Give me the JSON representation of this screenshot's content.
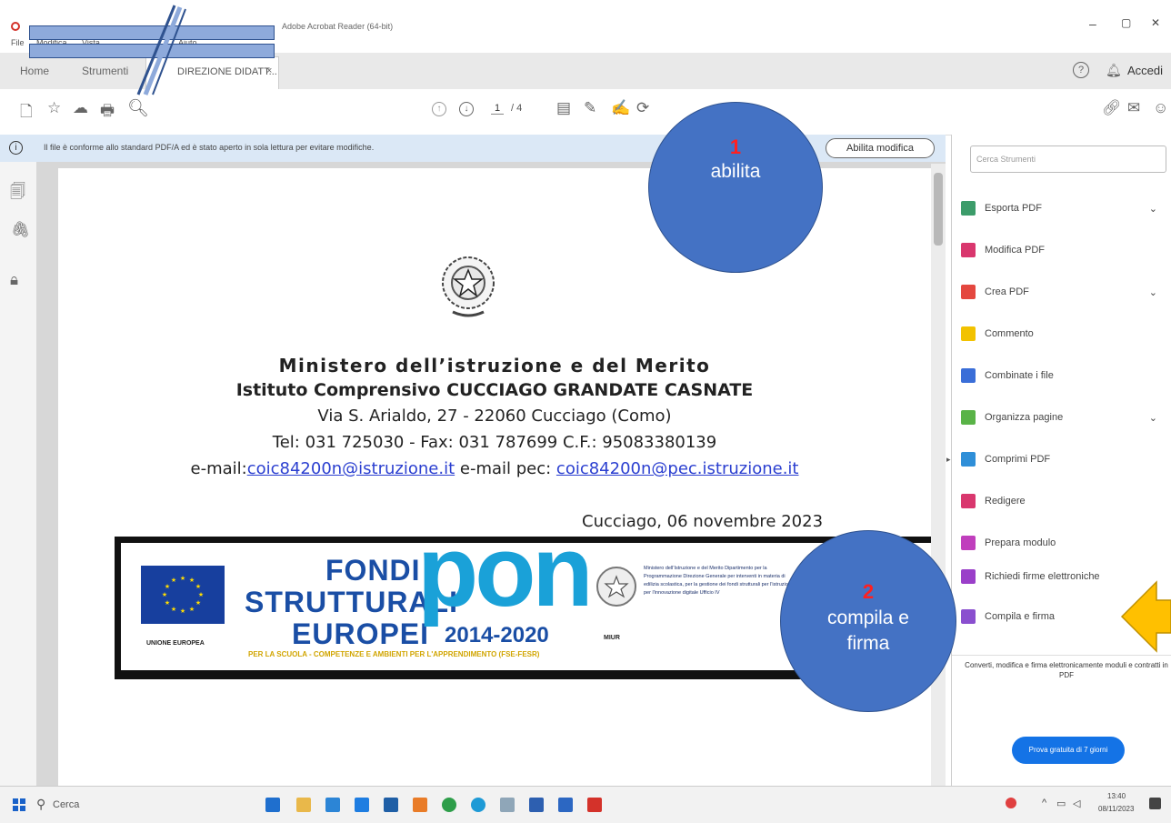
{
  "window": {
    "title": "Adobe Acrobat Reader (64-bit)",
    "minimize": "–",
    "maximize": "▢",
    "close": "✕"
  },
  "menu": {
    "file": "File",
    "modifica": "Modifica",
    "vista": "Vista",
    "aiuto": "Aiuto"
  },
  "tabs": {
    "home": "Home",
    "strumenti": "Strumenti",
    "document": "DIREZIONE DIDATT...",
    "document_close": "×",
    "accedi": "Accedi"
  },
  "toolbar": {
    "page_current": "1",
    "page_total": "/ 4"
  },
  "infobar": {
    "message": "Il file è conforme allo standard PDF/A ed è stato aperto in sola lettura per evitare modifiche.",
    "enable_button": "Abilita modifica"
  },
  "document": {
    "heading1": "Ministero dell’istruzione e del Merito",
    "heading2": "Istituto Comprensivo CUCCIAGO GRANDATE CASNATE",
    "address": "Via S. Arialdo, 27 - 22060 Cucciago (Como)",
    "phone": "Tel: 031 725030 - Fax: 031 787699 C.F.: 95083380139",
    "email_label": "e-mail:",
    "email": "coic84200n@istruzione.it",
    "pec_label": " e-mail pec: ",
    "pec": "coic84200n@pec.istruzione.it",
    "date": "Cucciago, 06 novembre  2023",
    "banner": {
      "eu_label": "UNIONE EUROPEA",
      "fondi1": "FONDI",
      "fondi2": "STRUTTURALI",
      "fondi3": "EUROPEI",
      "pon": "pon",
      "years": "2014-2020",
      "miur": "MIUR",
      "ministry_text": "Ministero dell'Istruzione e del Merito Dipartimento per la Programmazione Direzione Generale per interventi in materia di edilizia scolastica, per la gestione dei fondi strutturali per l'istruzione e per l'innovazione digitale Ufficio IV",
      "footer": "PER LA SCUOLA - COMPETENZE E AMBIENTI PER L'APPRENDIMENTO (FSE-FESR)"
    }
  },
  "right_panel": {
    "search_placeholder": "Cerca Strumenti",
    "items": [
      {
        "label": "Esporta PDF",
        "color": "#3c9c6a"
      },
      {
        "label": "Modifica PDF",
        "color": "#d9376e"
      },
      {
        "label": "Crea PDF",
        "color": "#e4473f"
      },
      {
        "label": "Commento",
        "color": "#f2c200"
      },
      {
        "label": "Combinate i file",
        "color": "#3a6ed8"
      },
      {
        "label": "Organizza pagine",
        "color": "#59b347"
      },
      {
        "label": "Comprimi PDF",
        "color": "#2f8fd8"
      },
      {
        "label": "Redigere",
        "color": "#d9376e"
      },
      {
        "label": "Prepara modulo",
        "color": "#c03fbd"
      },
      {
        "label": "Richiedi firme elettroniche",
        "color": "#9a3fc9"
      },
      {
        "label": "Compila e firma",
        "color": "#8a4fcf"
      }
    ],
    "promo": "Converti, modifica e firma elettronicamente moduli e contratti in PDF",
    "trial_button": "Prova gratuita di 7 giorni"
  },
  "taskbar": {
    "search": "Cerca",
    "time": "13:40",
    "date": "08/11/2023"
  },
  "callouts": [
    {
      "num": "1",
      "label": "abilita"
    },
    {
      "num": "2",
      "label": "compila e firma"
    }
  ],
  "colors": {
    "callout": "#4472c4",
    "arrow": "#ffc000",
    "link": "#2b3fd0"
  }
}
